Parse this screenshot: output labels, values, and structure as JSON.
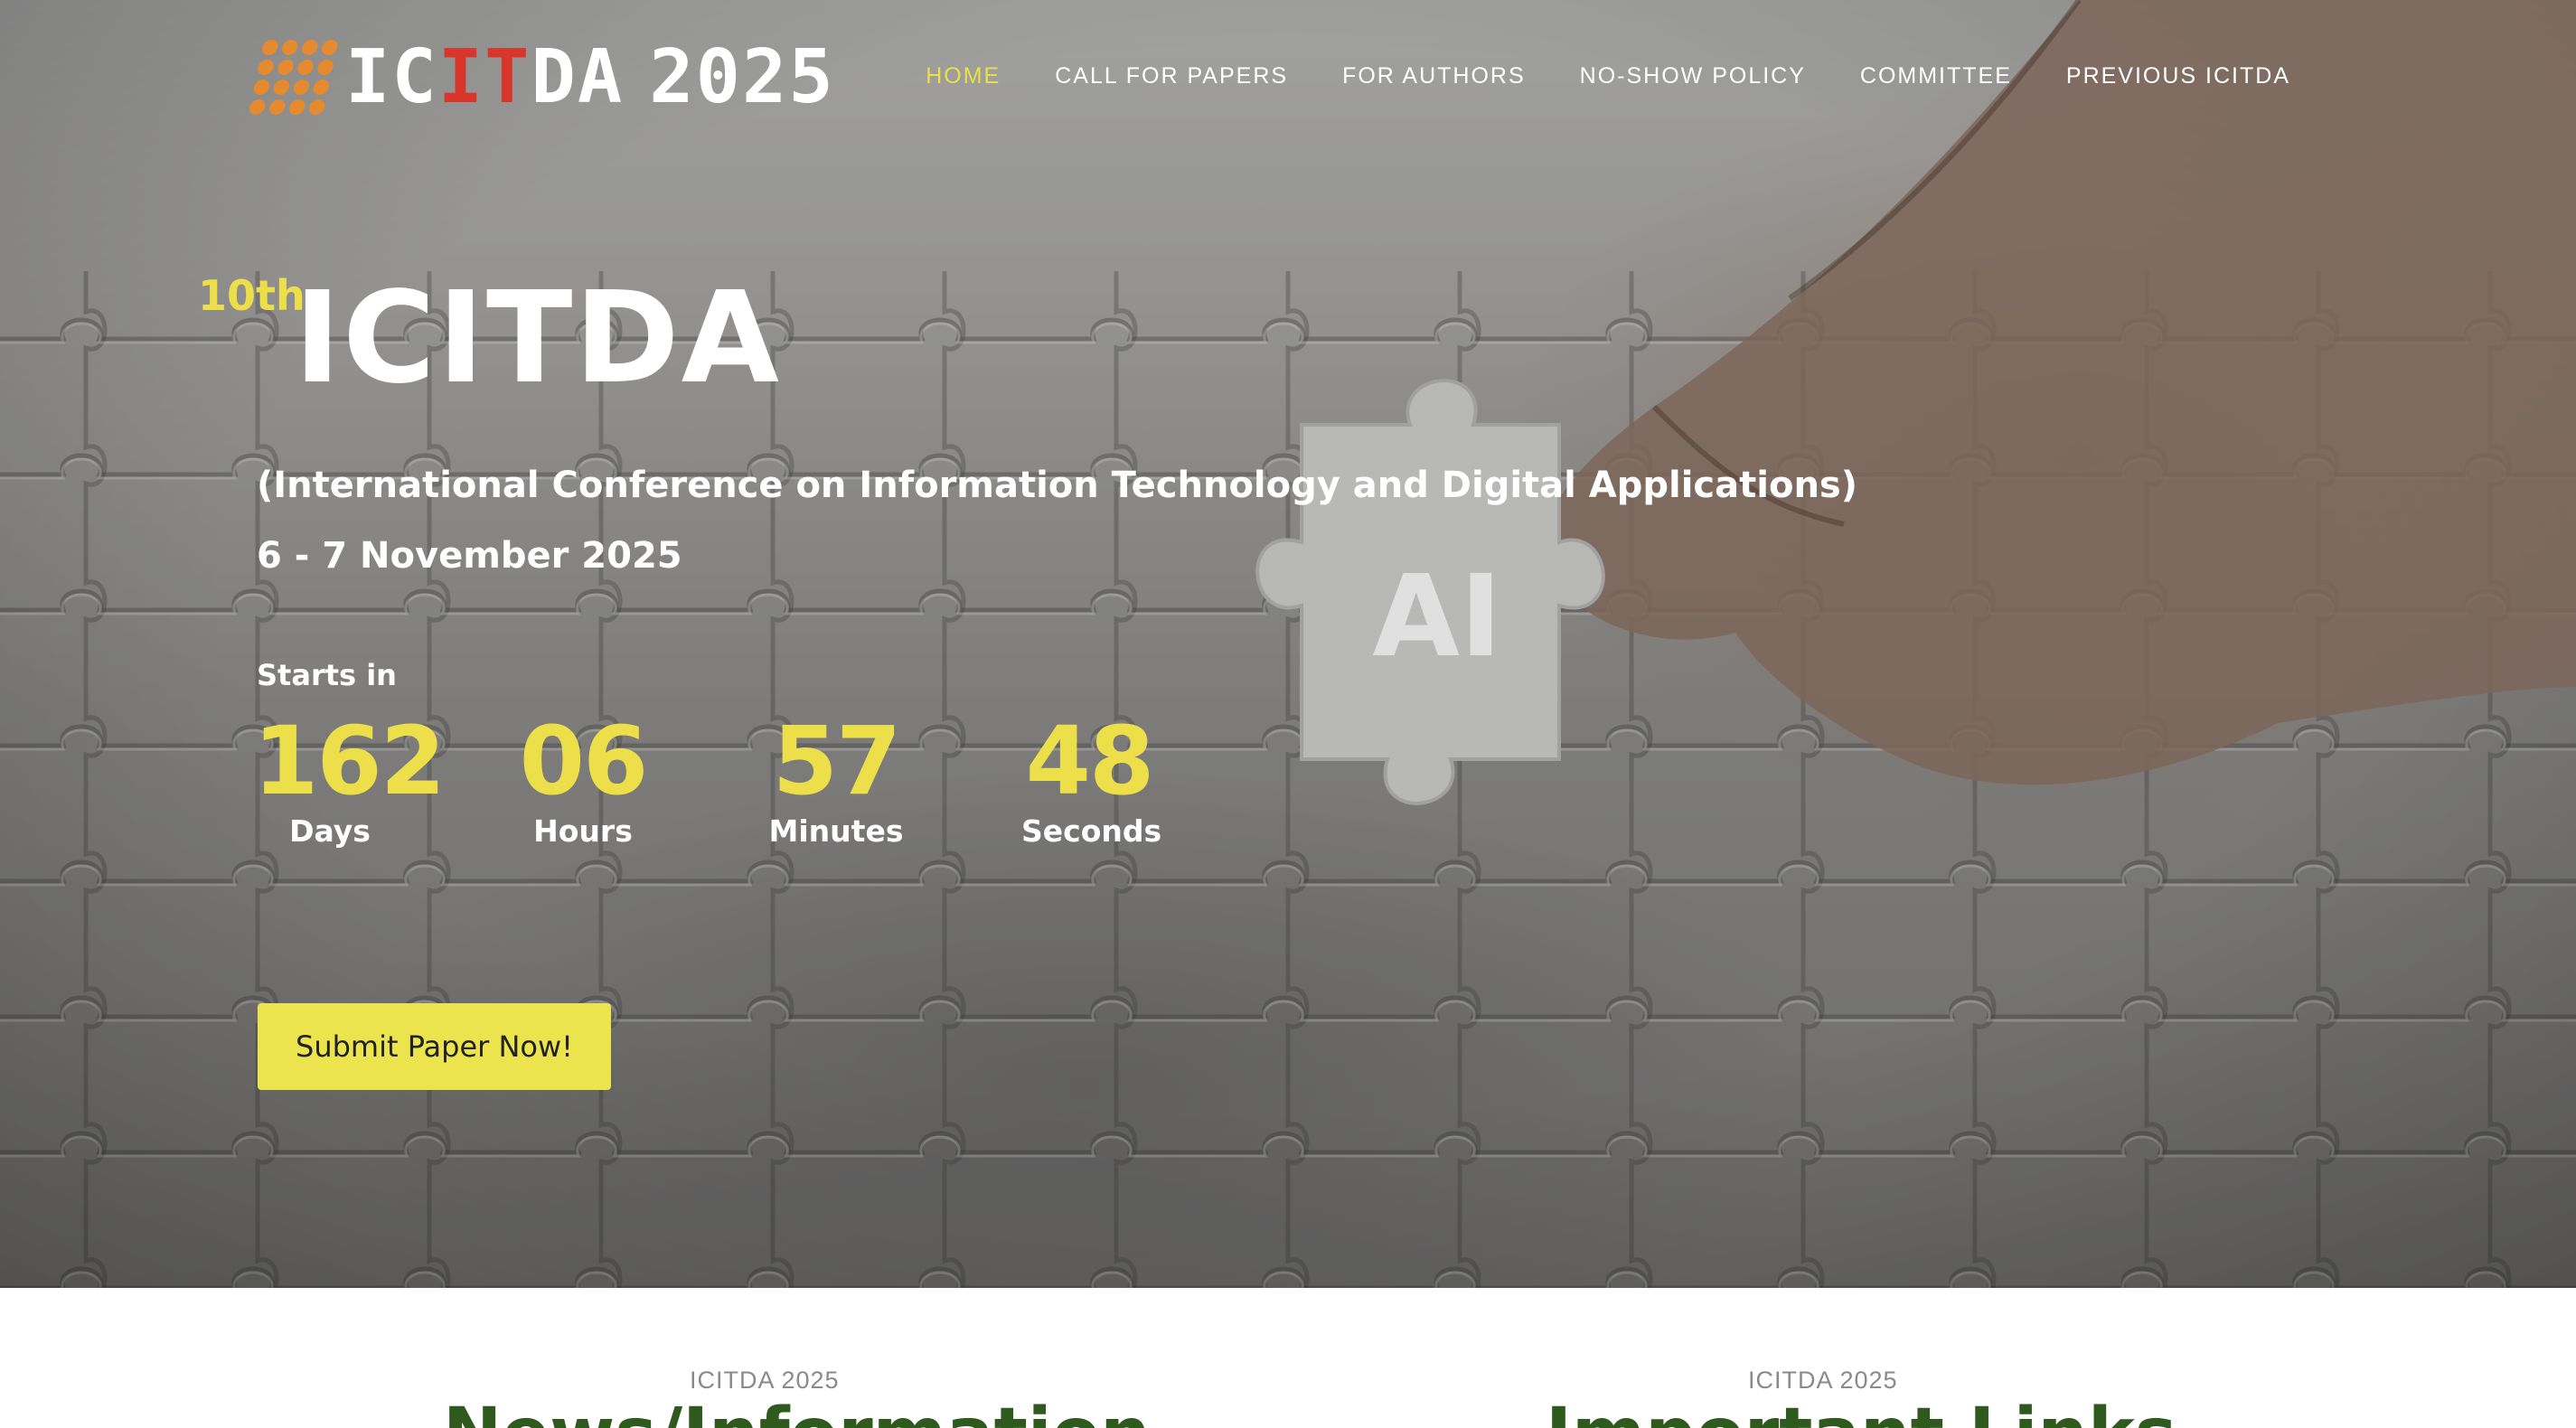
{
  "header": {
    "logo_parts": [
      "IC",
      "IT",
      "DA"
    ],
    "logo_year": "2025",
    "nav": [
      {
        "label": "HOME",
        "active": true
      },
      {
        "label": "CALL FOR PAPERS",
        "active": false
      },
      {
        "label": "FOR AUTHORS",
        "active": false
      },
      {
        "label": "NO-SHOW POLICY",
        "active": false
      },
      {
        "label": "COMMITTEE",
        "active": false
      },
      {
        "label": "PREVIOUS ICITDA",
        "active": false
      }
    ]
  },
  "hero": {
    "edition": "10th",
    "title": "ICITDA",
    "subtitle": "(International Conference on Information Technology and Digital Applications)",
    "dates": "6 - 7 November 2025",
    "starts_label": "Starts in",
    "puzzle_piece_text": "AI",
    "countdown": [
      {
        "value": "162",
        "label": "Days"
      },
      {
        "value": "06",
        "label": "Hours"
      },
      {
        "value": "57",
        "label": "Minutes"
      },
      {
        "value": "48",
        "label": "Seconds"
      }
    ],
    "cta_label": "Submit Paper Now!"
  },
  "sections": [
    {
      "kicker": "ICITDA 2025",
      "heading": "News/Information"
    },
    {
      "kicker": "ICITDA 2025",
      "heading": "Important Links"
    }
  ],
  "colors": {
    "accent_yellow": "#ecdf4a",
    "logo_orange": "#e58a2f",
    "logo_red": "#d9362b",
    "heading_green": "#2f5a1e"
  }
}
